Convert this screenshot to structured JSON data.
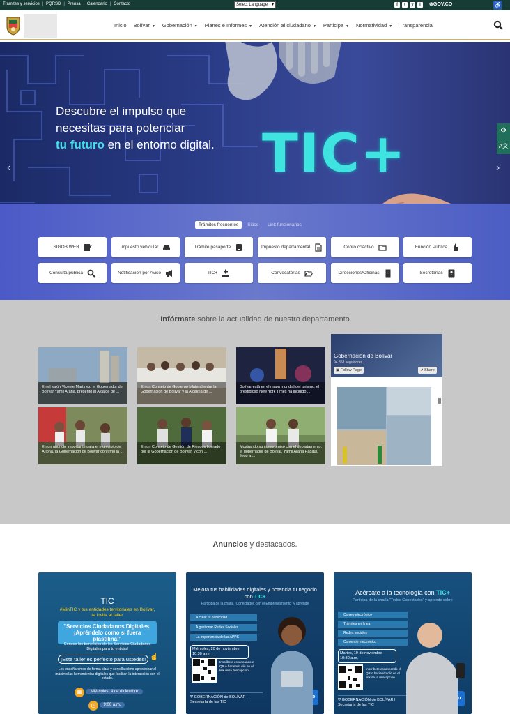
{
  "topbar": {
    "links": [
      "Trámites y servicios",
      "PQRSD",
      "Prensa",
      "Calendario",
      "Contacto"
    ],
    "language_select": "Select Language",
    "social": [
      "f",
      "t",
      "y",
      "i"
    ],
    "govco": "GOV.CO"
  },
  "nav": {
    "items": [
      {
        "label": "Inicio",
        "dropdown": false
      },
      {
        "label": "Bolívar",
        "dropdown": true
      },
      {
        "label": "Gobernación",
        "dropdown": true
      },
      {
        "label": "Planes e Informes",
        "dropdown": true
      },
      {
        "label": "Atención al ciudadano",
        "dropdown": true
      },
      {
        "label": "Participa",
        "dropdown": true
      },
      {
        "label": "Normatividad",
        "dropdown": true
      },
      {
        "label": "Transparencia",
        "dropdown": false
      }
    ]
  },
  "hero": {
    "line1": "Descubre el impulso que",
    "line2": "necesitas para potenciar",
    "line3_highlight": "tu futuro",
    "line3_rest": " en el entorno digital.",
    "logo_text": "TIC+"
  },
  "tramites": {
    "tabs": [
      "Trámites frecuentes",
      "Sitios",
      "Link funcionarios"
    ],
    "active_tab": 0,
    "buttons": [
      {
        "label": "SIGOB WEB",
        "icon": "sign-icon"
      },
      {
        "label": "Impuesto vehicular",
        "icon": "car-icon"
      },
      {
        "label": "Trámite pasaporte",
        "icon": "passport-icon"
      },
      {
        "label": "Impuesto departamental",
        "icon": "document-icon"
      },
      {
        "label": "Cobro coactivo",
        "icon": "folder-icon"
      },
      {
        "label": "Función Pública",
        "icon": "hand-icon"
      },
      {
        "label": "Consulta pública",
        "icon": "search-icon"
      },
      {
        "label": "Notificación por Aviso",
        "icon": "megaphone-icon"
      },
      {
        "label": "TIC+",
        "icon": "hand-plus-icon"
      },
      {
        "label": "Convocatorias",
        "icon": "open-folder-icon"
      },
      {
        "label": "Direcciones/Oficinas",
        "icon": "building-icon"
      },
      {
        "label": "Secretarías",
        "icon": "contact-card-icon"
      }
    ]
  },
  "news": {
    "title_bold": "Infórmate",
    "title_rest": " sobre la actualidad de nuestro departamento",
    "cards": [
      {
        "caption": "En el salón Vicente Martínez, el Gobernador de Bolívar Yamil Arana, presentó al Alcalde de ..."
      },
      {
        "caption": "En un Consejo de Gobierno bilateral entre la Gobernación de Bolívar y la Alcaldía de ..."
      },
      {
        "caption": "Bolívar está en el mapa mundial del turismo: el prestigioso New York Times ha incluido ..."
      },
      {
        "caption": "En un anuncio importante para el municipio de Arjona, la Gobernación de Bolívar confirmó la ..."
      },
      {
        "caption": "En un Consejo de Gestión de Riesgos liderado por la Gobernación de Bolívar, y con ..."
      },
      {
        "caption": "Mostrando su compromiso con el departamento, el gobernador de Bolívar, Yamil Arana Padauí, llegó a ..."
      }
    ],
    "facebook": {
      "page_name": "Gobernación de Bolívar",
      "followers": "94.358 seguidores",
      "follow_label": "Follow Page",
      "share_label": "Share"
    }
  },
  "anuncios": {
    "title_bold": "Anuncios",
    "title_rest": " y destacados."
  },
  "promos": [
    {
      "brand": "TIC",
      "intro": "#MinTIC y tus entidades territoriales en Bolívar, te invita al taller",
      "headline": "\"Servicios Ciudadanos Digitales: ¡Apréndelo como si fuera plastilina!\"",
      "sub": "Conoce los beneficios de los Servicios Ciudadanos Digitales para tu entidad",
      "cta": "¡Este taller es perfecto para ustedes!",
      "body": "Les enseñaremos de forma clara y sencilla cómo aprovechar al máximo las herramientas digitales que facilitan la interacción con el estado.",
      "date": "Miércoles, 4 de diciembre",
      "time": "9:00 a.m."
    },
    {
      "headline": "Mejora tus habilidades digitales y potencia tu negocio con",
      "brand": "TIC+",
      "sub": "Participa de la charla \"Conectados con el Emprendimiento\" y aprende",
      "items": [
        "A crear tu publicidad",
        "A gestionar Redes Sociales",
        "La importancia de las APPS"
      ],
      "date": "Miércoles, 20 de noviembre",
      "time": "10:30 a.m.",
      "qr_text": "Inscríbete escaneando el QR o haciendo clic en el link de la descripción",
      "org1": "GOBERNACIÓN de BOLÍVAR",
      "org2": "Secretaría de las TIC",
      "partner": "tigo"
    },
    {
      "headline": "Acércate a la tecnología con",
      "brand": "TIC+",
      "sub": "Participa de la charla \"Todos Conectados\" y aprende sobre",
      "items": [
        "Correo electrónico",
        "Trámites en línea",
        "Redes sociales",
        "Comercio electrónico"
      ],
      "date": "Martes, 19 de noviembre",
      "time": "10:30 a.m.",
      "qr_text": "Inscríbete escaneando el QR o haciendo clic en el link de la descripción",
      "org1": "GOBERNACIÓN de BOLÍVAR",
      "org2": "Secretaría de las TIC",
      "partner": "tigo"
    }
  ]
}
